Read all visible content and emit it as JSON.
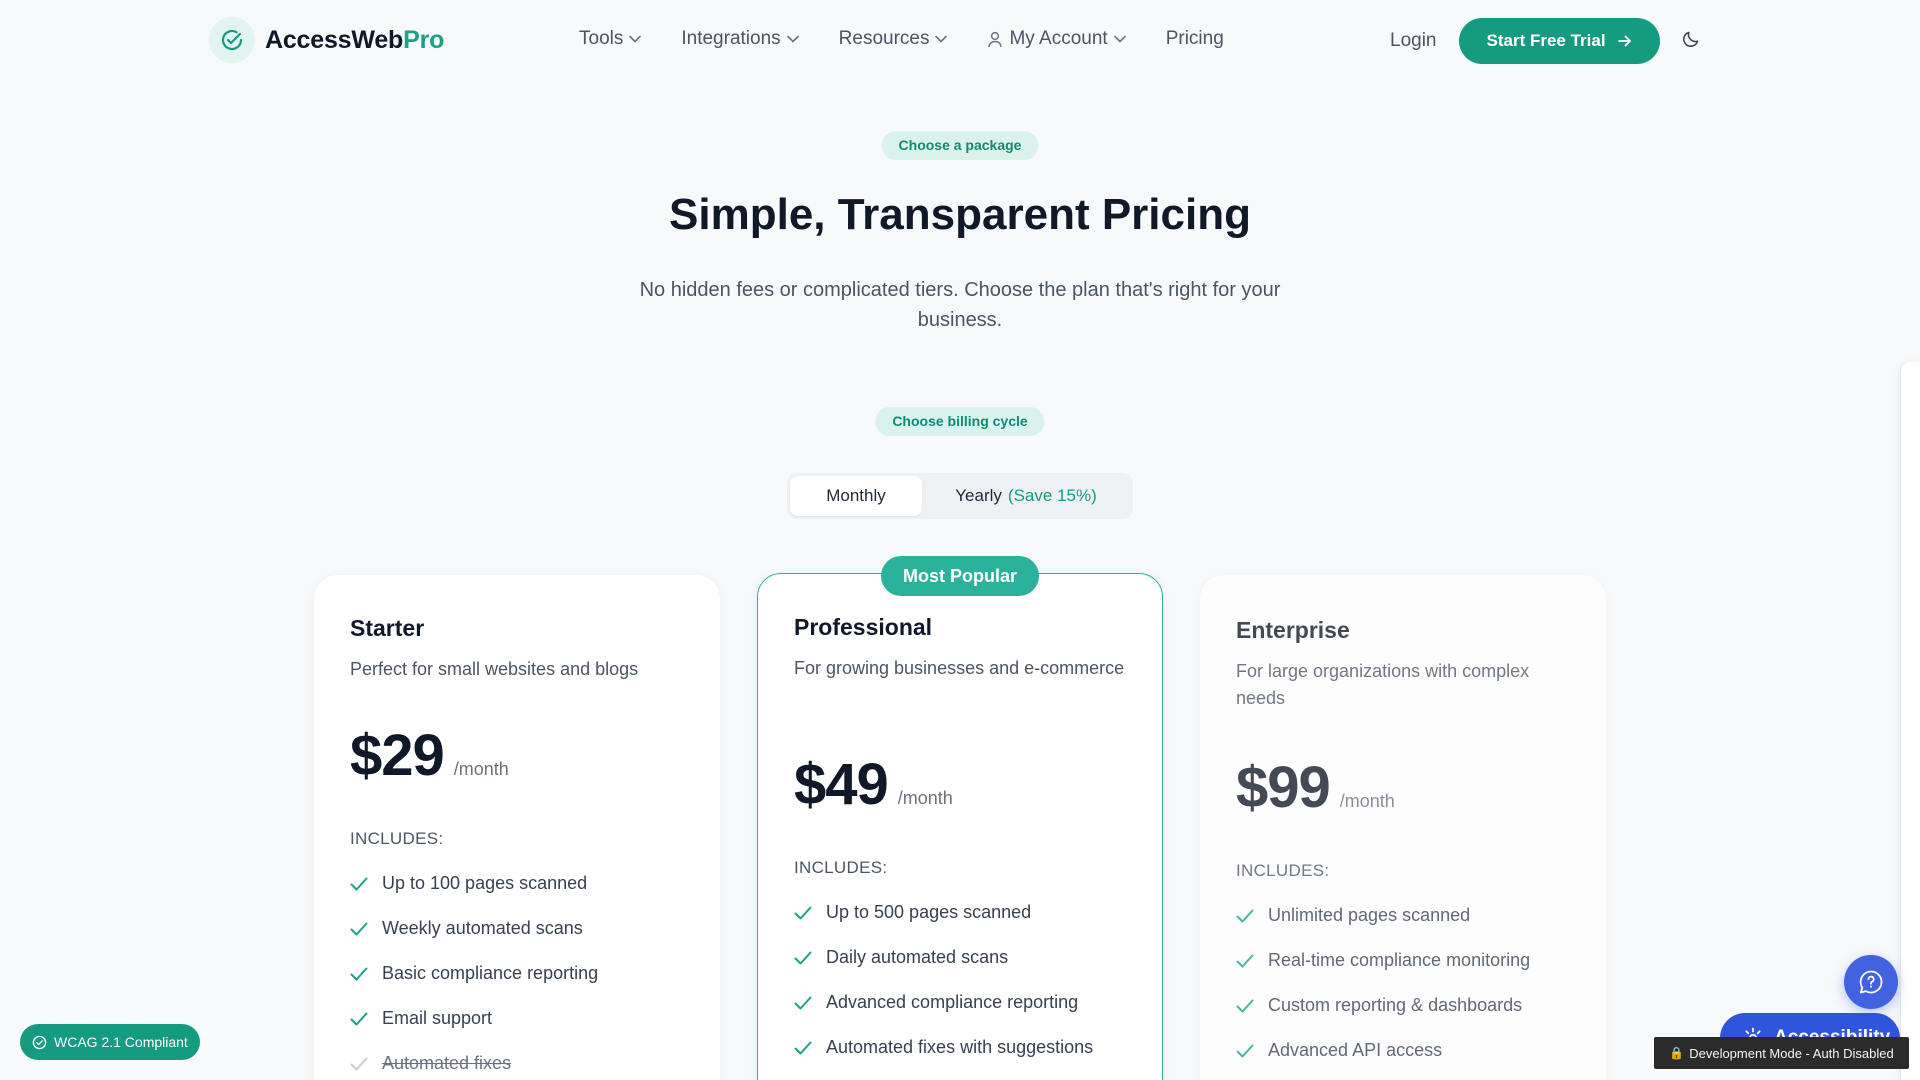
{
  "nav": {
    "logo_prefix": "AccessWeb",
    "logo_suffix": "Pro",
    "menu": [
      {
        "label": "Tools"
      },
      {
        "label": "Integrations"
      },
      {
        "label": "Resources"
      },
      {
        "label": "My Account"
      },
      {
        "label": "Pricing"
      }
    ],
    "login": "Login",
    "cta": "Start Free Trial"
  },
  "hero": {
    "eyebrow": "Choose a package",
    "title": "Simple, Transparent Pricing",
    "subtitle": "No hidden fees or complicated tiers. Choose the plan that's right for your business.",
    "billing_label": "Choose billing cycle",
    "monthly": "Monthly",
    "yearly": "Yearly",
    "yearly_save": "(Save 15%)"
  },
  "plans": [
    {
      "name": "Starter",
      "desc": "Perfect for small websites and blogs",
      "price": "$29",
      "period": "/month",
      "includes": "INCLUDES:",
      "features": [
        {
          "text": "Up to 100 pages scanned",
          "included": true
        },
        {
          "text": "Weekly automated scans",
          "included": true
        },
        {
          "text": "Basic compliance reporting",
          "included": true
        },
        {
          "text": "Email support",
          "included": true
        },
        {
          "text": "Automated fixes",
          "included": false
        }
      ]
    },
    {
      "badge": "Most Popular",
      "name": "Professional",
      "desc": "For growing businesses and e-commerce",
      "price": "$49",
      "period": "/month",
      "includes": "INCLUDES:",
      "features": [
        {
          "text": "Up to 500 pages scanned",
          "included": true
        },
        {
          "text": "Daily automated scans",
          "included": true
        },
        {
          "text": "Advanced compliance reporting",
          "included": true
        },
        {
          "text": "Automated fixes with suggestions",
          "included": true
        }
      ]
    },
    {
      "name": "Enterprise",
      "desc": "For large organizations with complex needs",
      "price": "$99",
      "period": "/month",
      "includes": "INCLUDES:",
      "features": [
        {
          "text": "Unlimited pages scanned",
          "included": true
        },
        {
          "text": "Real-time compliance monitoring",
          "included": true
        },
        {
          "text": "Custom reporting & dashboards",
          "included": true
        },
        {
          "text": "Advanced API access",
          "included": true
        }
      ]
    }
  ],
  "floating": {
    "wcag": "WCAG 2.1 Compliant",
    "accessibility": "Accessibility",
    "dev_mode": "Development Mode - Auth Disabled"
  },
  "colors": {
    "brand": "#149b80",
    "accent_blue": "#2f55dd"
  }
}
